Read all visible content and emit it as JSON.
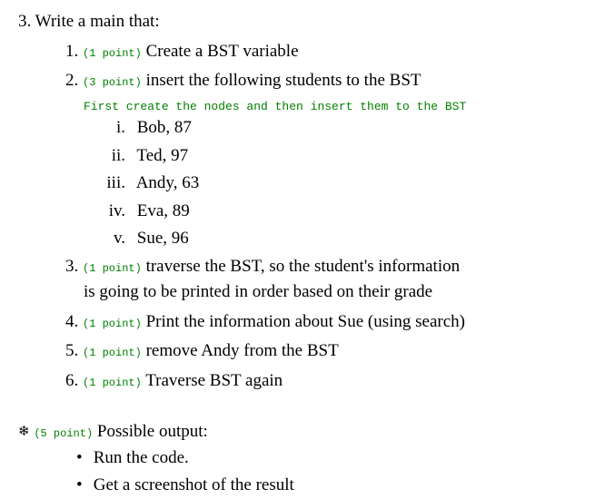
{
  "main": {
    "number": "3.",
    "text": "Write a main that:"
  },
  "subitems": [
    {
      "number": "1.",
      "points": "(1 point)",
      "text": " Create a BST variable"
    },
    {
      "number": "2.",
      "points": "(3 point)",
      "text": " insert the following students to the BST"
    }
  ],
  "note": "First create the nodes and then insert them to the BST",
  "students": [
    {
      "marker": "i.",
      "text": "Bob, 87"
    },
    {
      "marker": "ii.",
      "text": "Ted, 97"
    },
    {
      "marker": "iii.",
      "text": "Andy, 63"
    },
    {
      "marker": "iv.",
      "text": "Eva, 89"
    },
    {
      "marker": "v.",
      "text": "Sue, 96"
    }
  ],
  "subitems2": [
    {
      "number": "3.",
      "points": "(1 point)",
      "text": " traverse the BST, so the student's information",
      "cont": "is going to be printed in order based on their grade"
    },
    {
      "number": "4.",
      "points": "(1 point)",
      "text": " Print the information about Sue (using search)"
    },
    {
      "number": "5.",
      "points": "(1 point)",
      "text": " remove Andy from the BST"
    },
    {
      "number": "6.",
      "points": "(1 point)",
      "text": " Traverse BST again"
    }
  ],
  "output": {
    "points": "(5 point)",
    "label": " Possible output:",
    "bullets": [
      "Run the code.",
      "Get a screenshot of the result"
    ]
  }
}
